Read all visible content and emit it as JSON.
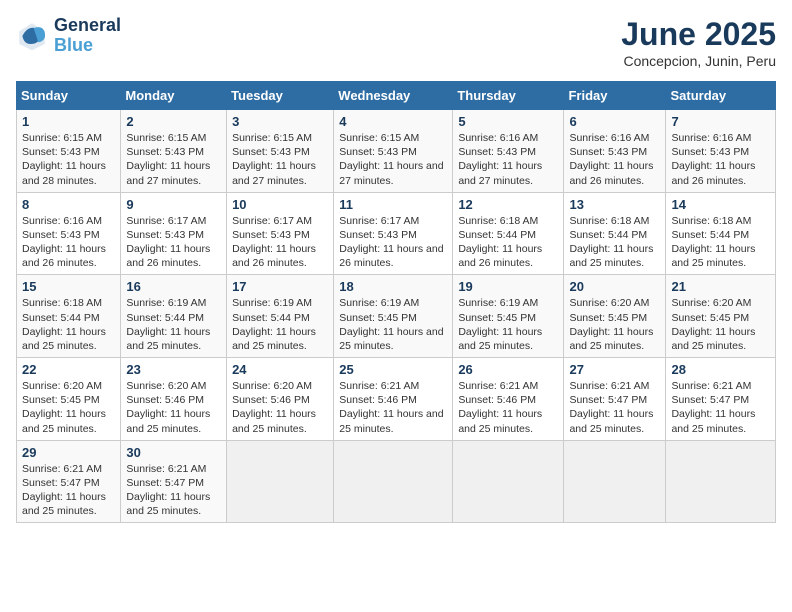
{
  "logo": {
    "line1": "General",
    "line2": "Blue"
  },
  "title": "June 2025",
  "subtitle": "Concepcion, Junin, Peru",
  "days_of_week": [
    "Sunday",
    "Monday",
    "Tuesday",
    "Wednesday",
    "Thursday",
    "Friday",
    "Saturday"
  ],
  "weeks": [
    [
      {
        "num": "1",
        "info": "Sunrise: 6:15 AM\nSunset: 5:43 PM\nDaylight: 11 hours and 28 minutes."
      },
      {
        "num": "2",
        "info": "Sunrise: 6:15 AM\nSunset: 5:43 PM\nDaylight: 11 hours and 27 minutes."
      },
      {
        "num": "3",
        "info": "Sunrise: 6:15 AM\nSunset: 5:43 PM\nDaylight: 11 hours and 27 minutes."
      },
      {
        "num": "4",
        "info": "Sunrise: 6:15 AM\nSunset: 5:43 PM\nDaylight: 11 hours and 27 minutes."
      },
      {
        "num": "5",
        "info": "Sunrise: 6:16 AM\nSunset: 5:43 PM\nDaylight: 11 hours and 27 minutes."
      },
      {
        "num": "6",
        "info": "Sunrise: 6:16 AM\nSunset: 5:43 PM\nDaylight: 11 hours and 26 minutes."
      },
      {
        "num": "7",
        "info": "Sunrise: 6:16 AM\nSunset: 5:43 PM\nDaylight: 11 hours and 26 minutes."
      }
    ],
    [
      {
        "num": "8",
        "info": "Sunrise: 6:16 AM\nSunset: 5:43 PM\nDaylight: 11 hours and 26 minutes."
      },
      {
        "num": "9",
        "info": "Sunrise: 6:17 AM\nSunset: 5:43 PM\nDaylight: 11 hours and 26 minutes."
      },
      {
        "num": "10",
        "info": "Sunrise: 6:17 AM\nSunset: 5:43 PM\nDaylight: 11 hours and 26 minutes."
      },
      {
        "num": "11",
        "info": "Sunrise: 6:17 AM\nSunset: 5:43 PM\nDaylight: 11 hours and 26 minutes."
      },
      {
        "num": "12",
        "info": "Sunrise: 6:18 AM\nSunset: 5:44 PM\nDaylight: 11 hours and 26 minutes."
      },
      {
        "num": "13",
        "info": "Sunrise: 6:18 AM\nSunset: 5:44 PM\nDaylight: 11 hours and 25 minutes."
      },
      {
        "num": "14",
        "info": "Sunrise: 6:18 AM\nSunset: 5:44 PM\nDaylight: 11 hours and 25 minutes."
      }
    ],
    [
      {
        "num": "15",
        "info": "Sunrise: 6:18 AM\nSunset: 5:44 PM\nDaylight: 11 hours and 25 minutes."
      },
      {
        "num": "16",
        "info": "Sunrise: 6:19 AM\nSunset: 5:44 PM\nDaylight: 11 hours and 25 minutes."
      },
      {
        "num": "17",
        "info": "Sunrise: 6:19 AM\nSunset: 5:44 PM\nDaylight: 11 hours and 25 minutes."
      },
      {
        "num": "18",
        "info": "Sunrise: 6:19 AM\nSunset: 5:45 PM\nDaylight: 11 hours and 25 minutes."
      },
      {
        "num": "19",
        "info": "Sunrise: 6:19 AM\nSunset: 5:45 PM\nDaylight: 11 hours and 25 minutes."
      },
      {
        "num": "20",
        "info": "Sunrise: 6:20 AM\nSunset: 5:45 PM\nDaylight: 11 hours and 25 minutes."
      },
      {
        "num": "21",
        "info": "Sunrise: 6:20 AM\nSunset: 5:45 PM\nDaylight: 11 hours and 25 minutes."
      }
    ],
    [
      {
        "num": "22",
        "info": "Sunrise: 6:20 AM\nSunset: 5:45 PM\nDaylight: 11 hours and 25 minutes."
      },
      {
        "num": "23",
        "info": "Sunrise: 6:20 AM\nSunset: 5:46 PM\nDaylight: 11 hours and 25 minutes."
      },
      {
        "num": "24",
        "info": "Sunrise: 6:20 AM\nSunset: 5:46 PM\nDaylight: 11 hours and 25 minutes."
      },
      {
        "num": "25",
        "info": "Sunrise: 6:21 AM\nSunset: 5:46 PM\nDaylight: 11 hours and 25 minutes."
      },
      {
        "num": "26",
        "info": "Sunrise: 6:21 AM\nSunset: 5:46 PM\nDaylight: 11 hours and 25 minutes."
      },
      {
        "num": "27",
        "info": "Sunrise: 6:21 AM\nSunset: 5:47 PM\nDaylight: 11 hours and 25 minutes."
      },
      {
        "num": "28",
        "info": "Sunrise: 6:21 AM\nSunset: 5:47 PM\nDaylight: 11 hours and 25 minutes."
      }
    ],
    [
      {
        "num": "29",
        "info": "Sunrise: 6:21 AM\nSunset: 5:47 PM\nDaylight: 11 hours and 25 minutes."
      },
      {
        "num": "30",
        "info": "Sunrise: 6:21 AM\nSunset: 5:47 PM\nDaylight: 11 hours and 25 minutes."
      },
      {
        "num": "",
        "info": ""
      },
      {
        "num": "",
        "info": ""
      },
      {
        "num": "",
        "info": ""
      },
      {
        "num": "",
        "info": ""
      },
      {
        "num": "",
        "info": ""
      }
    ]
  ]
}
